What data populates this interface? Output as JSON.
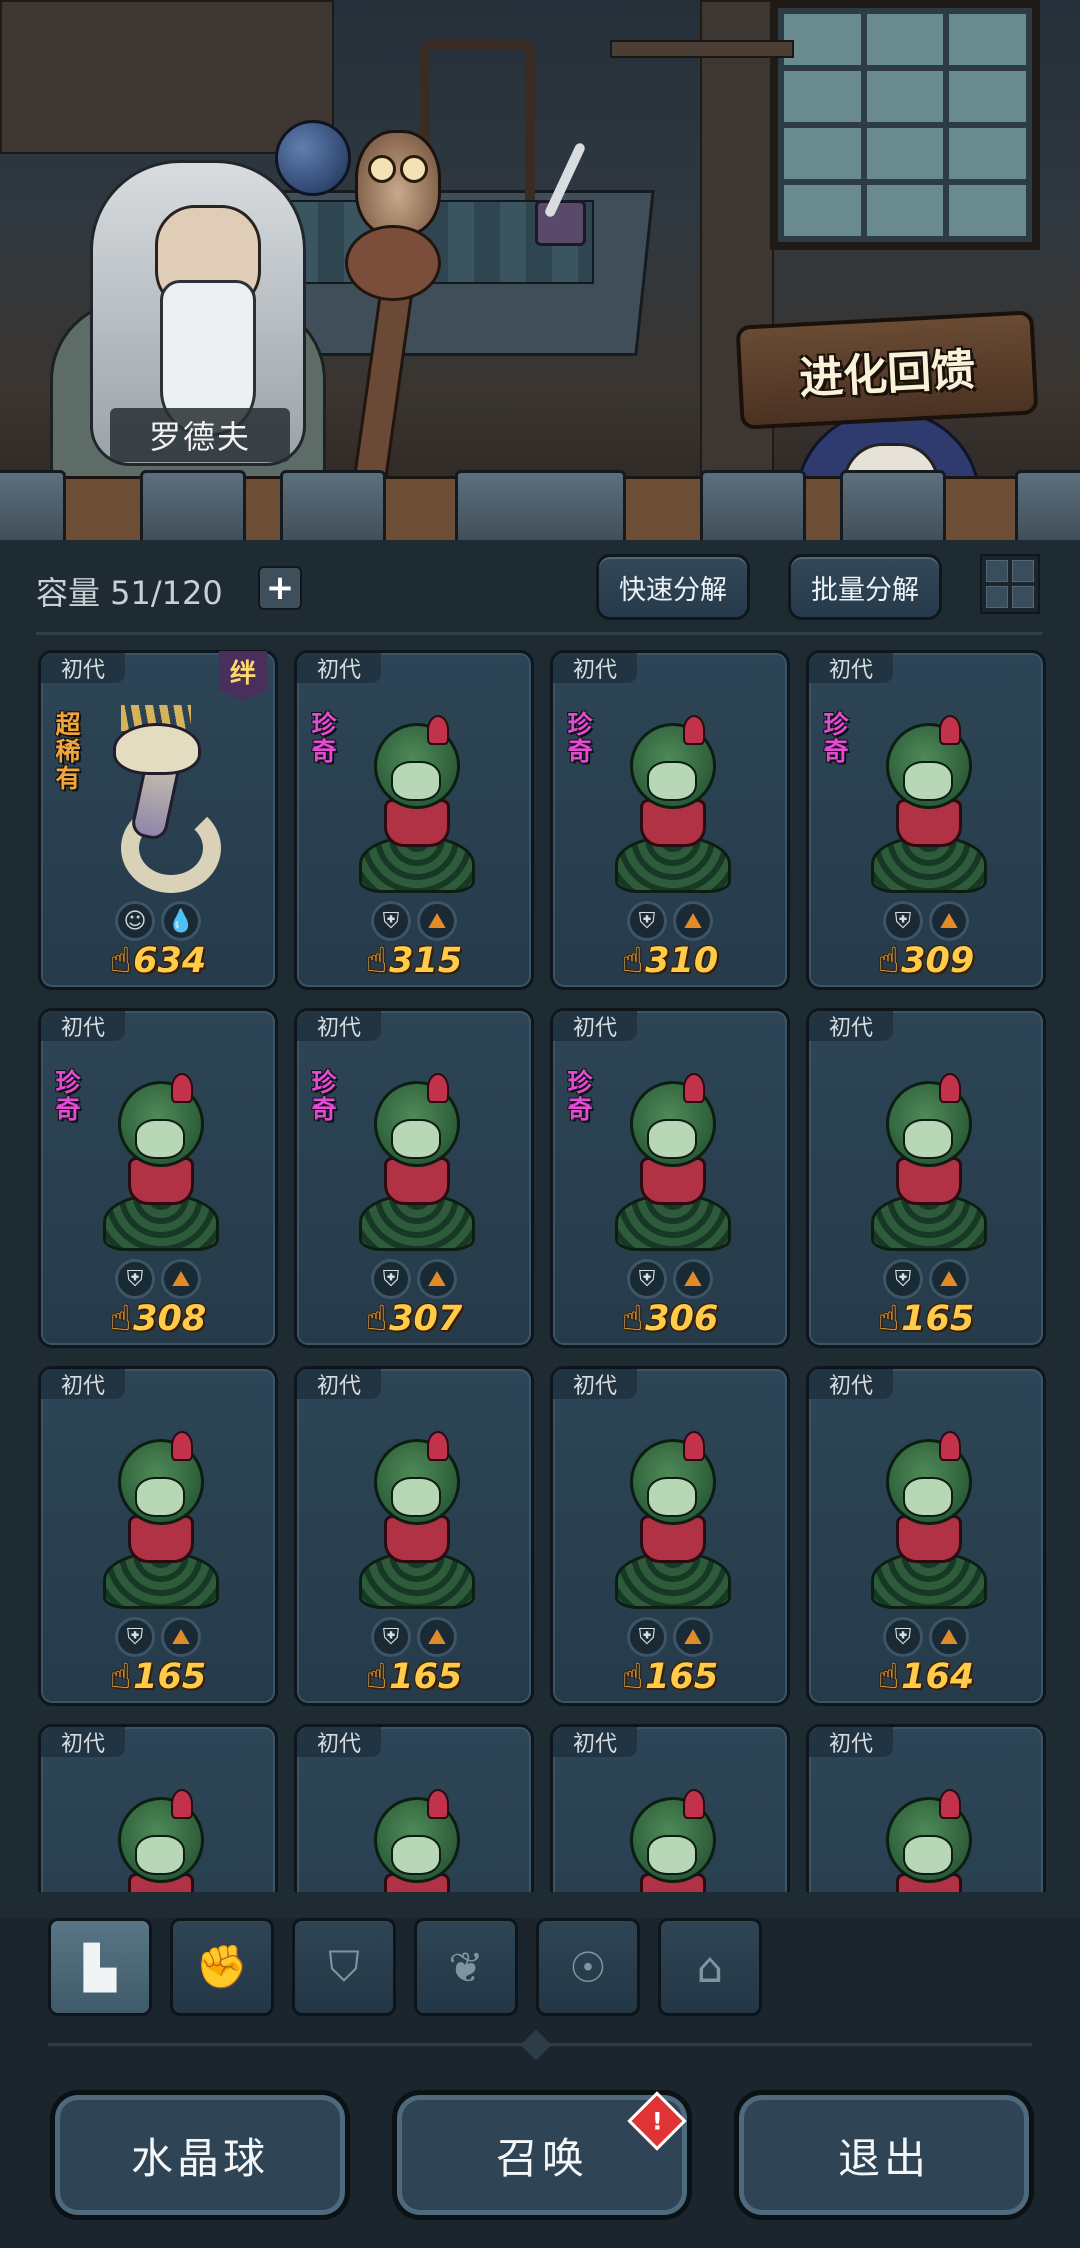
{
  "scene": {
    "npc_name": "罗德夫",
    "evolution_sign": "进化回馈"
  },
  "toolbar": {
    "capacity_label": "容量 51/120",
    "add_icon": "plus-icon",
    "quick_decompose": "快速分解",
    "batch_decompose": "批量分解",
    "view_toggle_icon": "grid-view-icon"
  },
  "cards": [
    {
      "gen": "初代",
      "bond": "绊",
      "rarity": "超稀有",
      "rarity_type": "super",
      "monster": "serpent",
      "traits": [
        "alien",
        "water"
      ],
      "power": "634"
    },
    {
      "gen": "初代",
      "bond": "",
      "rarity": "珍奇",
      "rarity_type": "rare",
      "monster": "plant",
      "traits": [
        "shield",
        "rock"
      ],
      "power": "315"
    },
    {
      "gen": "初代",
      "bond": "",
      "rarity": "珍奇",
      "rarity_type": "rare",
      "monster": "plant",
      "traits": [
        "shield",
        "rock"
      ],
      "power": "310"
    },
    {
      "gen": "初代",
      "bond": "",
      "rarity": "珍奇",
      "rarity_type": "rare",
      "monster": "plant",
      "traits": [
        "shield",
        "rock"
      ],
      "power": "309"
    },
    {
      "gen": "初代",
      "bond": "",
      "rarity": "珍奇",
      "rarity_type": "rare",
      "monster": "plant",
      "traits": [
        "shield",
        "rock"
      ],
      "power": "308"
    },
    {
      "gen": "初代",
      "bond": "",
      "rarity": "珍奇",
      "rarity_type": "rare",
      "monster": "plant",
      "traits": [
        "shield",
        "rock"
      ],
      "power": "307"
    },
    {
      "gen": "初代",
      "bond": "",
      "rarity": "珍奇",
      "rarity_type": "rare",
      "monster": "plant",
      "traits": [
        "shield",
        "rock"
      ],
      "power": "306"
    },
    {
      "gen": "初代",
      "bond": "",
      "rarity": "",
      "rarity_type": "",
      "monster": "plant",
      "traits": [
        "shield",
        "rock"
      ],
      "power": "165"
    },
    {
      "gen": "初代",
      "bond": "",
      "rarity": "",
      "rarity_type": "",
      "monster": "plant",
      "traits": [
        "shield",
        "rock"
      ],
      "power": "165"
    },
    {
      "gen": "初代",
      "bond": "",
      "rarity": "",
      "rarity_type": "",
      "monster": "plant",
      "traits": [
        "shield",
        "rock"
      ],
      "power": "165"
    },
    {
      "gen": "初代",
      "bond": "",
      "rarity": "",
      "rarity_type": "",
      "monster": "plant",
      "traits": [
        "shield",
        "rock"
      ],
      "power": "165"
    },
    {
      "gen": "初代",
      "bond": "",
      "rarity": "",
      "rarity_type": "",
      "monster": "plant",
      "traits": [
        "shield",
        "rock"
      ],
      "power": "164"
    },
    {
      "gen": "初代",
      "bond": "",
      "rarity": "",
      "rarity_type": "",
      "monster": "plant",
      "traits": [],
      "power": ""
    },
    {
      "gen": "初代",
      "bond": "",
      "rarity": "",
      "rarity_type": "",
      "monster": "plant",
      "traits": [],
      "power": ""
    },
    {
      "gen": "初代",
      "bond": "",
      "rarity": "",
      "rarity_type": "",
      "monster": "plant",
      "traits": [],
      "power": ""
    },
    {
      "gen": "初代",
      "bond": "",
      "rarity": "",
      "rarity_type": "",
      "monster": "plant",
      "traits": [],
      "power": ""
    }
  ],
  "filter_tabs": [
    {
      "icon": "all-blocks-icon",
      "active": true
    },
    {
      "icon": "fist-icon",
      "active": false
    },
    {
      "icon": "winged-shield-icon",
      "active": false
    },
    {
      "icon": "sprout-icon",
      "active": false
    },
    {
      "icon": "alien-head-icon",
      "active": false
    },
    {
      "icon": "shrine-icon",
      "active": false
    }
  ],
  "bottom": {
    "crystal_ball": "水晶球",
    "summon": "召唤",
    "summon_badge": "!",
    "exit": "退出"
  },
  "colors": {
    "rare": "#e34bd6",
    "super_rare": "#f2a53a",
    "power": "#ffcc4a",
    "card_bg": "#2d4556"
  }
}
